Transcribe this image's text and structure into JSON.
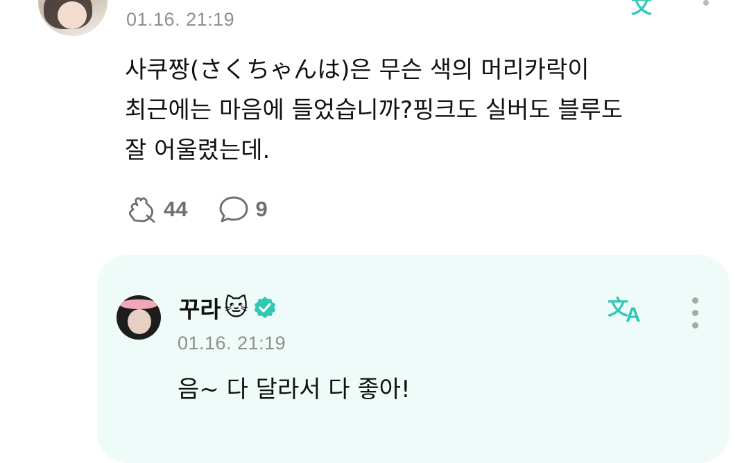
{
  "post": {
    "timestamp": "01.16. 21:19",
    "text_lines": [
      "사쿠짱(さくちゃんは)은 무슨 색의 머리카락이",
      "최근에는 마음에 들었습니까?핑크도 실버도 블루도",
      "잘 어울렸는데."
    ],
    "like_count": "44",
    "comment_count": "9",
    "translate_icon": "translate-icon",
    "more_icon": "more-vertical-icon"
  },
  "reply": {
    "author_name": "꾸라",
    "author_emoji": "🐱",
    "verified_icon": "verified-badge-icon",
    "timestamp": "01.16. 21:19",
    "text": "음~ 다 달라서 다 좋아!",
    "translate_icon": "translate-icon",
    "more_icon": "more-vertical-icon"
  },
  "colors": {
    "accent": "#32c8b6",
    "reply_background": "#effbf8",
    "muted_text": "#8e8e8e",
    "count_text": "#6f6f6f"
  }
}
